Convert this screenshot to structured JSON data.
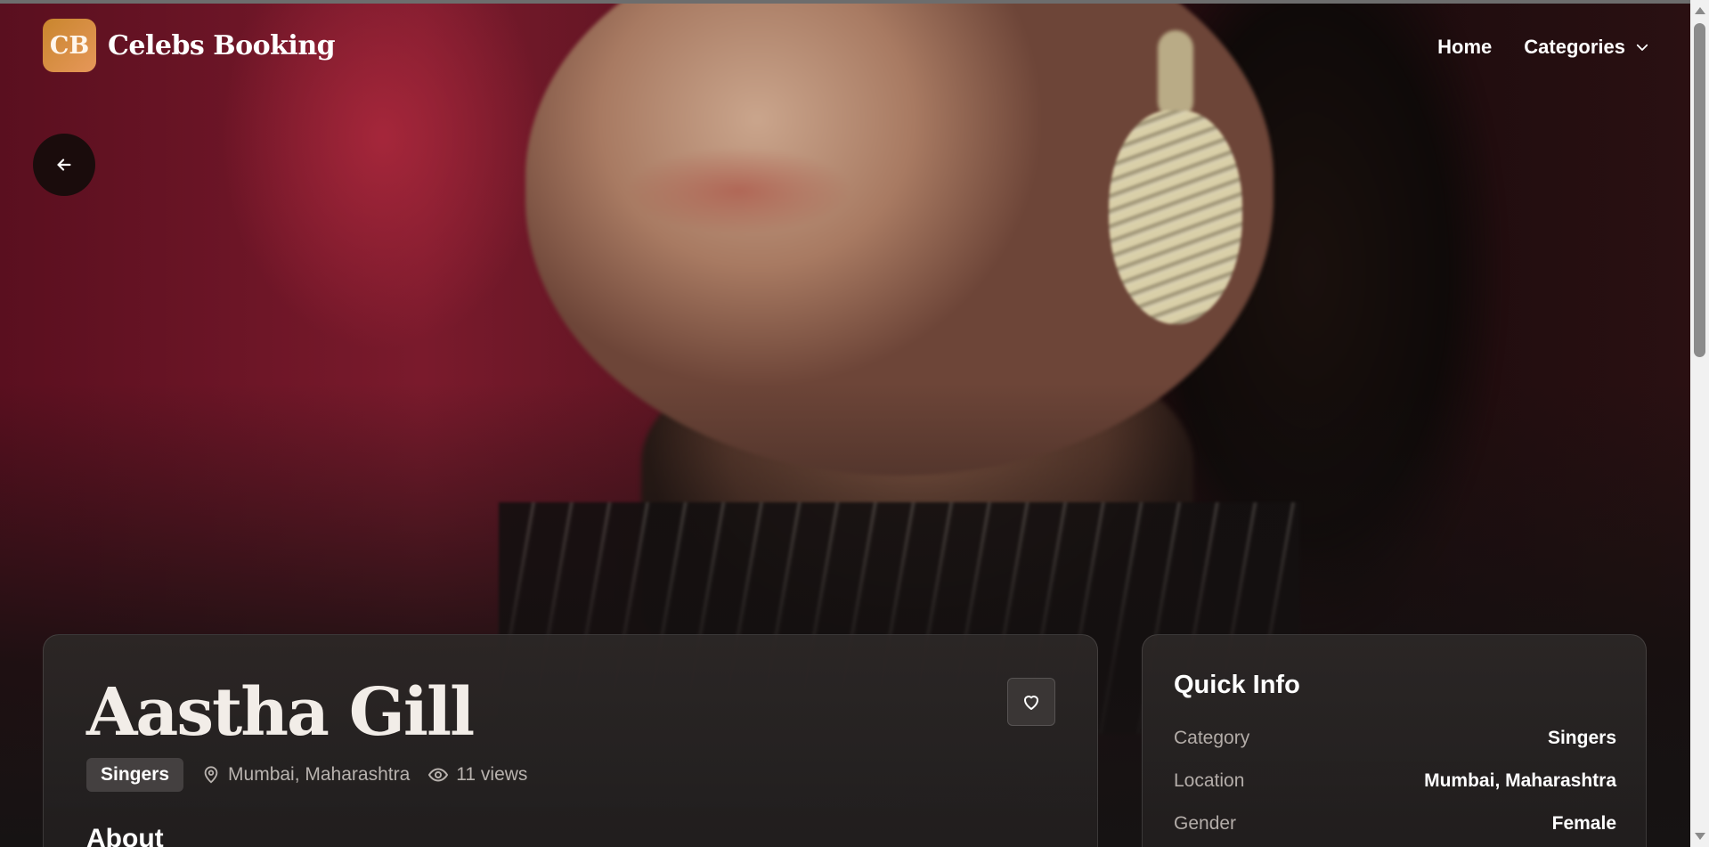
{
  "brand": {
    "mark": "CB",
    "name": "Celebs Booking"
  },
  "nav": {
    "home": "Home",
    "categories": "Categories"
  },
  "profile": {
    "name": "Aastha Gill",
    "category": "Singers",
    "location": "Mumbai, Maharashtra",
    "views": "11 views",
    "about_heading": "About"
  },
  "quick_info": {
    "title": "Quick Info",
    "rows": [
      {
        "label": "Category",
        "value": "Singers"
      },
      {
        "label": "Location",
        "value": "Mumbai, Maharashtra"
      },
      {
        "label": "Gender",
        "value": "Female"
      }
    ]
  },
  "icons": {
    "back": "arrow-left-icon",
    "favorite": "heart-icon",
    "location": "map-pin-icon",
    "views": "eye-icon",
    "dropdown": "chevron-down-icon"
  },
  "colors": {
    "accent": "#d98a3f",
    "card_bg": "#2b2726",
    "hero_red": "#7a1a2c"
  }
}
